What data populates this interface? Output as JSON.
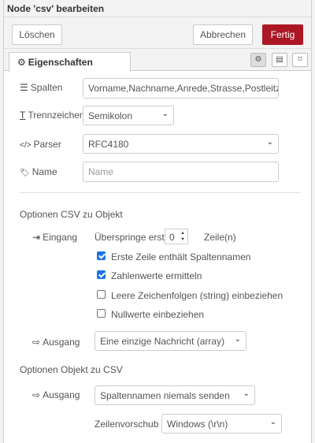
{
  "header": {
    "title": "Node 'csv' bearbeiten"
  },
  "toolbar": {
    "delete_label": "Löschen",
    "cancel_label": "Abbrechen",
    "done_label": "Fertig"
  },
  "tabs": {
    "properties_label": "Eigenschaften",
    "gear": "⚙",
    "doc": "▤",
    "frame": "⌑"
  },
  "fields": {
    "columns": {
      "label": "Spalten",
      "value": "Vorname,Nachname,Anrede,Strasse,Postleitzahl,"
    },
    "separator": {
      "label": "Trennzeichen",
      "value": "Semikolon"
    },
    "parser": {
      "label": "Parser",
      "value": "RFC4180"
    },
    "name": {
      "label": "Name",
      "placeholder": "Name"
    }
  },
  "csv_to_object": {
    "heading": "Optionen CSV zu Objekt",
    "input_label": "Eingang",
    "skip_prefix": "Überspringe erste",
    "skip_value": "0",
    "skip_suffix": "Zeile(n)",
    "options": [
      {
        "label": "Erste Zeile enthält Spaltennamen",
        "checked": true
      },
      {
        "label": "Zahlenwerte ermitteln",
        "checked": true
      },
      {
        "label": "Leere Zeichenfolgen (string) einbeziehen",
        "checked": false
      },
      {
        "label": "Nullwerte einbeziehen",
        "checked": false
      }
    ],
    "output_label": "Ausgang",
    "output_value": "Eine einzige Nachricht (array)"
  },
  "object_to_csv": {
    "heading": "Optionen Objekt zu CSV",
    "output_label": "Ausgang",
    "output_value": "Spaltennamen niemals senden",
    "line_ending_label": "Zeilenvorschub",
    "line_ending_value": "Windows (\\r\\n)"
  },
  "icons": {
    "list": "☰",
    "text": "T",
    "code": "</>",
    "tag": "🏷",
    "sign_in": "⇥",
    "sign_out": "⇨",
    "chevron": "⌄"
  }
}
